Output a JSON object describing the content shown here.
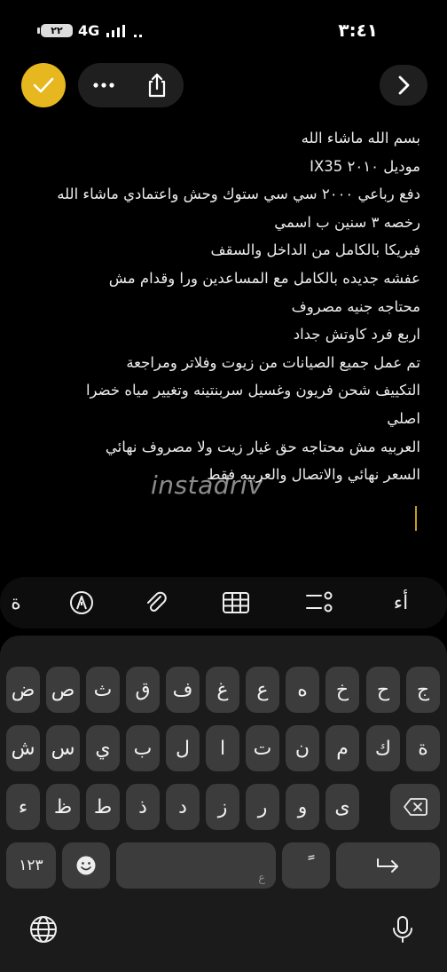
{
  "status_bar": {
    "battery": "٢٢",
    "network": "4G",
    "time": "٣:٤١"
  },
  "toolbar": {
    "done_icon": "checkmark-icon",
    "more_icon": "ellipsis-icon",
    "share_icon": "share-icon",
    "forward_icon": "chevron-right-icon",
    "accent_color": "#e6b71f"
  },
  "note": {
    "lines": [
      "بسم الله ماشاء الله",
      "موديل ٢٠١٠ IX35",
      "دفع رباعي ٢٠٠٠ سي سي ستوك وحش واعتمادي ماشاء الله",
      "رخصه ٣ سنين ب اسمي",
      "فبريكا بالكامل من الداخل والسقف",
      "عفشه جديده بالكامل مع المساعدين ورا وقدام مش",
      "محتاجه جنيه مصروف",
      "اربع فرد كاوتش جداد",
      "تم عمل جميع الصيانات من زيوت وفلاتر ومراجعة",
      "التكييف شحن فريون وغسيل سربنتينه وتغيير مياه خضرا",
      "اصلي",
      "العربيه مش محتاجه حق غيار زيت ولا مصروف نهائي",
      "السعر نهائي والاتصال والعربيه فقط"
    ],
    "watermark": "instadriv"
  },
  "format_bar": {
    "text_style_label": "أء",
    "partial_label": "ة"
  },
  "keyboard": {
    "row1": [
      "ج",
      "ح",
      "خ",
      "ه",
      "ع",
      "غ",
      "ف",
      "ق",
      "ث",
      "ص",
      "ض"
    ],
    "row2": [
      "ة",
      "ك",
      "م",
      "ن",
      "ت",
      "ا",
      "ل",
      "ب",
      "ي",
      "س",
      "ش"
    ],
    "row3": [
      "ى",
      "و",
      "ر",
      "ز",
      "د",
      "ذ",
      "ط",
      "ظ",
      "ء"
    ],
    "numbers_label": "١٢٣",
    "space_hint": "ع",
    "tanween_key": "ً"
  }
}
